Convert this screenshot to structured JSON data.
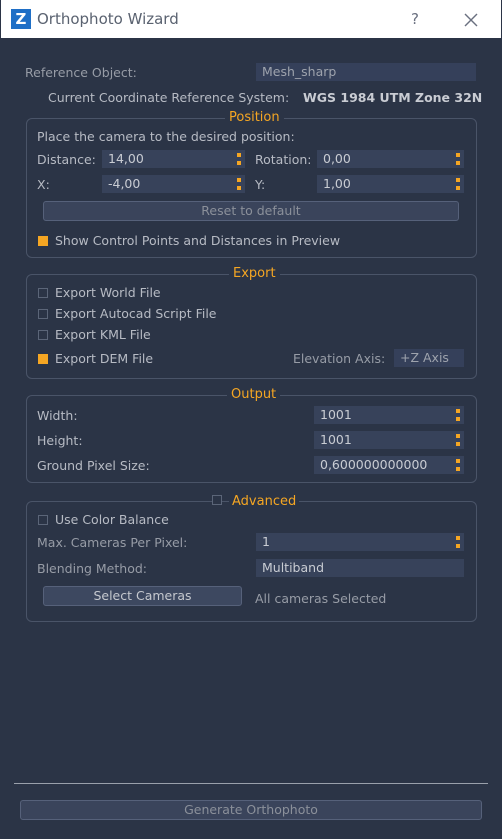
{
  "window": {
    "app_icon_letter": "Z",
    "title": "Orthophoto Wizard",
    "help_glyph": "?"
  },
  "reference": {
    "object_label": "Reference Object:",
    "object_value": "Mesh_sharp",
    "crs_label": "Current Coordinate Reference System:",
    "crs_value": "WGS 1984 UTM Zone 32N"
  },
  "position": {
    "title": "Position",
    "instruction": "Place the camera to the desired position:",
    "distance_label": "Distance:",
    "distance_value": "14,00",
    "rotation_label": "Rotation:",
    "rotation_value": "0,00",
    "x_label": "X:",
    "x_value": "-4,00",
    "y_label": "Y:",
    "y_value": "1,00",
    "reset_label": "Reset to default",
    "show_cp_label": "Show Control Points and Distances in Preview",
    "show_cp_checked": true
  },
  "export": {
    "title": "Export",
    "world_file_label": "Export World File",
    "world_file_checked": false,
    "autocad_label": "Export Autocad Script File",
    "autocad_checked": false,
    "kml_label": "Export KML File",
    "kml_checked": false,
    "dem_label": "Export DEM File",
    "dem_checked": true,
    "elevation_axis_label": "Elevation Axis:",
    "elevation_axis_value": "+Z Axis"
  },
  "output": {
    "title": "Output",
    "width_label": "Width:",
    "width_value": "1001",
    "height_label": "Height:",
    "height_value": "1001",
    "gps_label": "Ground Pixel Size:",
    "gps_value": "0,600000000000"
  },
  "advanced": {
    "title": "Advanced",
    "enabled": false,
    "color_balance_label": "Use Color Balance",
    "color_balance_checked": false,
    "max_cameras_label": "Max. Cameras Per Pixel:",
    "max_cameras_value": "1",
    "blending_label": "Blending Method:",
    "blending_value": "Multiband",
    "select_cameras_label": "Select Cameras",
    "cameras_status": "All cameras Selected"
  },
  "generate_label": "Generate Orthophoto",
  "colors": {
    "accent": "#f5a623",
    "background": "#2b3446",
    "field": "#37425a"
  }
}
